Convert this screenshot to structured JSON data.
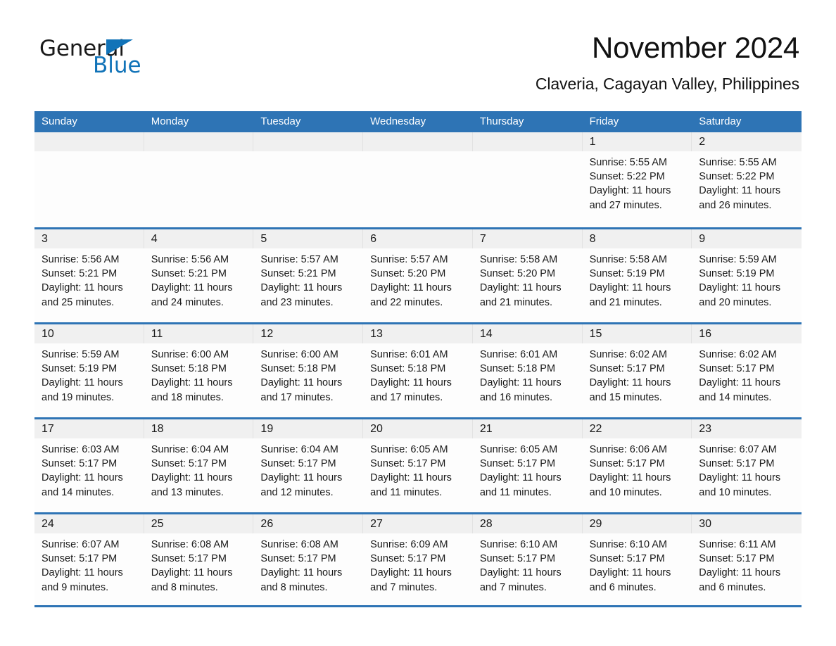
{
  "logo": {
    "part1": "General",
    "part2": "Blue",
    "triangle_color": "#1173b8"
  },
  "header": {
    "title": "November 2024",
    "location": "Claveria, Cagayan Valley, Philippines"
  },
  "theme": {
    "header_blue": "#2e74b5",
    "band_gray": "#f0f0f0",
    "text": "#1a1a1a"
  },
  "weekdays": [
    "Sunday",
    "Monday",
    "Tuesday",
    "Wednesday",
    "Thursday",
    "Friday",
    "Saturday"
  ],
  "labels": {
    "sunrise_prefix": "Sunrise:",
    "sunset_prefix": "Sunset:",
    "daylight_prefix": "Daylight:"
  },
  "weeks": [
    [
      {
        "day": "",
        "lines": []
      },
      {
        "day": "",
        "lines": []
      },
      {
        "day": "",
        "lines": []
      },
      {
        "day": "",
        "lines": []
      },
      {
        "day": "",
        "lines": []
      },
      {
        "day": "1",
        "lines": [
          "Sunrise: 5:55 AM",
          "Sunset: 5:22 PM",
          "Daylight: 11 hours",
          "and 27 minutes."
        ]
      },
      {
        "day": "2",
        "lines": [
          "Sunrise: 5:55 AM",
          "Sunset: 5:22 PM",
          "Daylight: 11 hours",
          "and 26 minutes."
        ]
      }
    ],
    [
      {
        "day": "3",
        "lines": [
          "Sunrise: 5:56 AM",
          "Sunset: 5:21 PM",
          "Daylight: 11 hours",
          "and 25 minutes."
        ]
      },
      {
        "day": "4",
        "lines": [
          "Sunrise: 5:56 AM",
          "Sunset: 5:21 PM",
          "Daylight: 11 hours",
          "and 24 minutes."
        ]
      },
      {
        "day": "5",
        "lines": [
          "Sunrise: 5:57 AM",
          "Sunset: 5:21 PM",
          "Daylight: 11 hours",
          "and 23 minutes."
        ]
      },
      {
        "day": "6",
        "lines": [
          "Sunrise: 5:57 AM",
          "Sunset: 5:20 PM",
          "Daylight: 11 hours",
          "and 22 minutes."
        ]
      },
      {
        "day": "7",
        "lines": [
          "Sunrise: 5:58 AM",
          "Sunset: 5:20 PM",
          "Daylight: 11 hours",
          "and 21 minutes."
        ]
      },
      {
        "day": "8",
        "lines": [
          "Sunrise: 5:58 AM",
          "Sunset: 5:19 PM",
          "Daylight: 11 hours",
          "and 21 minutes."
        ]
      },
      {
        "day": "9",
        "lines": [
          "Sunrise: 5:59 AM",
          "Sunset: 5:19 PM",
          "Daylight: 11 hours",
          "and 20 minutes."
        ]
      }
    ],
    [
      {
        "day": "10",
        "lines": [
          "Sunrise: 5:59 AM",
          "Sunset: 5:19 PM",
          "Daylight: 11 hours",
          "and 19 minutes."
        ]
      },
      {
        "day": "11",
        "lines": [
          "Sunrise: 6:00 AM",
          "Sunset: 5:18 PM",
          "Daylight: 11 hours",
          "and 18 minutes."
        ]
      },
      {
        "day": "12",
        "lines": [
          "Sunrise: 6:00 AM",
          "Sunset: 5:18 PM",
          "Daylight: 11 hours",
          "and 17 minutes."
        ]
      },
      {
        "day": "13",
        "lines": [
          "Sunrise: 6:01 AM",
          "Sunset: 5:18 PM",
          "Daylight: 11 hours",
          "and 17 minutes."
        ]
      },
      {
        "day": "14",
        "lines": [
          "Sunrise: 6:01 AM",
          "Sunset: 5:18 PM",
          "Daylight: 11 hours",
          "and 16 minutes."
        ]
      },
      {
        "day": "15",
        "lines": [
          "Sunrise: 6:02 AM",
          "Sunset: 5:17 PM",
          "Daylight: 11 hours",
          "and 15 minutes."
        ]
      },
      {
        "day": "16",
        "lines": [
          "Sunrise: 6:02 AM",
          "Sunset: 5:17 PM",
          "Daylight: 11 hours",
          "and 14 minutes."
        ]
      }
    ],
    [
      {
        "day": "17",
        "lines": [
          "Sunrise: 6:03 AM",
          "Sunset: 5:17 PM",
          "Daylight: 11 hours",
          "and 14 minutes."
        ]
      },
      {
        "day": "18",
        "lines": [
          "Sunrise: 6:04 AM",
          "Sunset: 5:17 PM",
          "Daylight: 11 hours",
          "and 13 minutes."
        ]
      },
      {
        "day": "19",
        "lines": [
          "Sunrise: 6:04 AM",
          "Sunset: 5:17 PM",
          "Daylight: 11 hours",
          "and 12 minutes."
        ]
      },
      {
        "day": "20",
        "lines": [
          "Sunrise: 6:05 AM",
          "Sunset: 5:17 PM",
          "Daylight: 11 hours",
          "and 11 minutes."
        ]
      },
      {
        "day": "21",
        "lines": [
          "Sunrise: 6:05 AM",
          "Sunset: 5:17 PM",
          "Daylight: 11 hours",
          "and 11 minutes."
        ]
      },
      {
        "day": "22",
        "lines": [
          "Sunrise: 6:06 AM",
          "Sunset: 5:17 PM",
          "Daylight: 11 hours",
          "and 10 minutes."
        ]
      },
      {
        "day": "23",
        "lines": [
          "Sunrise: 6:07 AM",
          "Sunset: 5:17 PM",
          "Daylight: 11 hours",
          "and 10 minutes."
        ]
      }
    ],
    [
      {
        "day": "24",
        "lines": [
          "Sunrise: 6:07 AM",
          "Sunset: 5:17 PM",
          "Daylight: 11 hours",
          "and 9 minutes."
        ]
      },
      {
        "day": "25",
        "lines": [
          "Sunrise: 6:08 AM",
          "Sunset: 5:17 PM",
          "Daylight: 11 hours",
          "and 8 minutes."
        ]
      },
      {
        "day": "26",
        "lines": [
          "Sunrise: 6:08 AM",
          "Sunset: 5:17 PM",
          "Daylight: 11 hours",
          "and 8 minutes."
        ]
      },
      {
        "day": "27",
        "lines": [
          "Sunrise: 6:09 AM",
          "Sunset: 5:17 PM",
          "Daylight: 11 hours",
          "and 7 minutes."
        ]
      },
      {
        "day": "28",
        "lines": [
          "Sunrise: 6:10 AM",
          "Sunset: 5:17 PM",
          "Daylight: 11 hours",
          "and 7 minutes."
        ]
      },
      {
        "day": "29",
        "lines": [
          "Sunrise: 6:10 AM",
          "Sunset: 5:17 PM",
          "Daylight: 11 hours",
          "and 6 minutes."
        ]
      },
      {
        "day": "30",
        "lines": [
          "Sunrise: 6:11 AM",
          "Sunset: 5:17 PM",
          "Daylight: 11 hours",
          "and 6 minutes."
        ]
      }
    ]
  ]
}
